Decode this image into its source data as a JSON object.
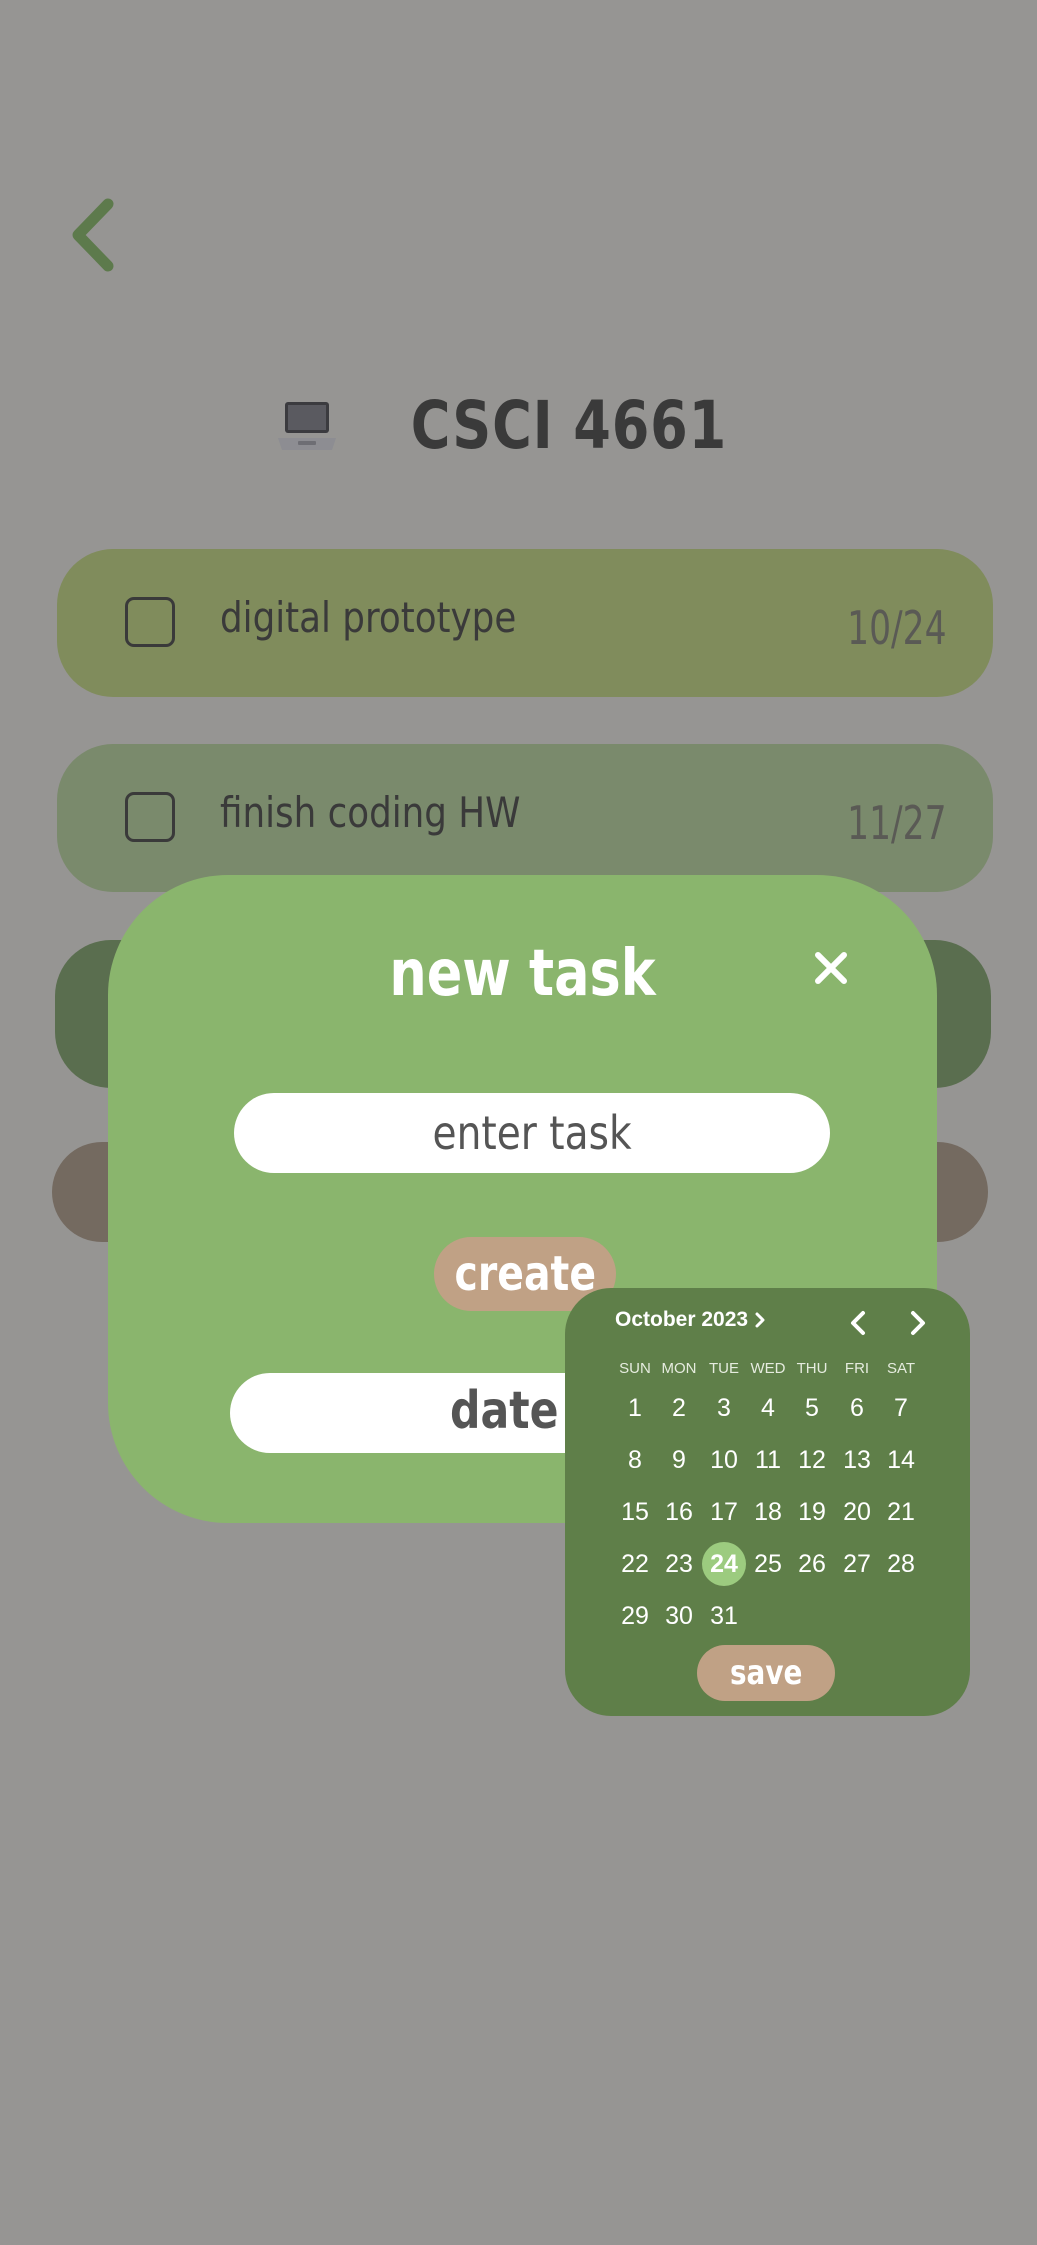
{
  "header": {
    "course_title": "CSCI 4661",
    "course_icon": "laptop-icon"
  },
  "nav": {
    "back_icon": "chevron-left-icon"
  },
  "tasks": [
    {
      "name": "digital prototype",
      "due": "10/24",
      "color": "#808c5c"
    },
    {
      "name": "finish coding HW",
      "due": "11/27",
      "color": "#7a8a6c"
    },
    {
      "name": "",
      "due": "",
      "color": "#5a6e4f"
    },
    {
      "name": "",
      "due": "",
      "color": "#746a60"
    }
  ],
  "modal": {
    "title": "new task",
    "close_icon": "close-icon",
    "task_input_placeholder": "enter task",
    "create_label": "create",
    "date_input_text": "date d"
  },
  "calendar": {
    "month_label": "October 2023",
    "weekdays": [
      "SUN",
      "MON",
      "TUE",
      "WED",
      "THU",
      "FRI",
      "SAT"
    ],
    "first_weekday_index": 0,
    "days_in_month": 31,
    "selected_day": 24,
    "save_label": "save"
  },
  "colors": {
    "backdrop": "#969593",
    "modal_bg": "#8ab56d",
    "calendar_bg": "#5f7f49",
    "accent_button": "#c0a185",
    "selected_day": "#9ccb7f"
  }
}
